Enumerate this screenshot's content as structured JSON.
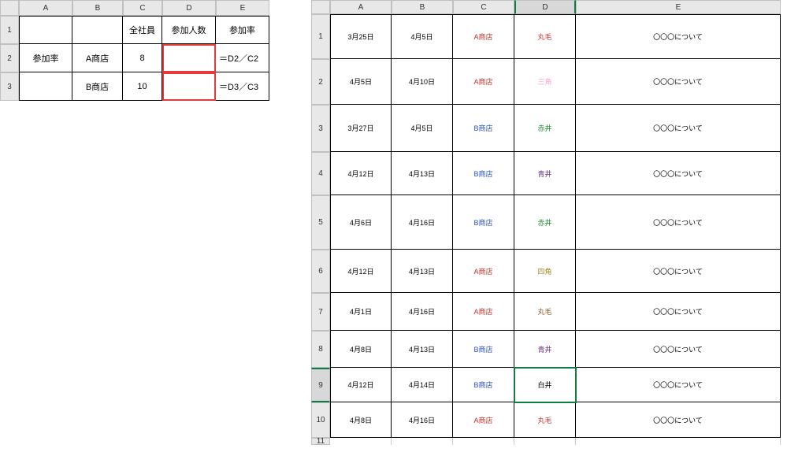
{
  "sheet1": {
    "col_headers": [
      "A",
      "B",
      "C",
      "D",
      "E"
    ],
    "row_headers": [
      "1",
      "2",
      "3"
    ],
    "cells": {
      "r1": {
        "a": "",
        "b": "",
        "c": "全社員",
        "d": "参加人数",
        "e": "参加率"
      },
      "r2": {
        "a": "参加率",
        "b": "A商店",
        "c": "8",
        "d": "",
        "e": "＝D2／C2"
      },
      "r3": {
        "a": "",
        "b": "B商店",
        "c": "10",
        "d": "",
        "e": "＝D3／C3"
      }
    }
  },
  "sheet2": {
    "col_headers": [
      "A",
      "B",
      "C",
      "D",
      "E"
    ],
    "row_headers": [
      "1",
      "2",
      "3",
      "4",
      "5",
      "6",
      "7",
      "8",
      "9",
      "10",
      "11"
    ],
    "selected_cell": "D9",
    "rows": [
      {
        "a": "3月25日",
        "b": "4月5日",
        "c": {
          "t": "A商店",
          "cls": "c-red"
        },
        "d": {
          "t": "丸毛",
          "cls": "c-red"
        },
        "e": "〇〇〇について"
      },
      {
        "a": "4月5日",
        "b": "4月10日",
        "c": {
          "t": "A商店",
          "cls": "c-red"
        },
        "d": {
          "t": "三角",
          "cls": "c-pink"
        },
        "e": "〇〇〇について"
      },
      {
        "a": "3月27日",
        "b": "4月5日",
        "c": {
          "t": "B商店",
          "cls": "c-blue"
        },
        "d": {
          "t": "赤井",
          "cls": "c-green"
        },
        "e": "〇〇〇について"
      },
      {
        "a": "4月12日",
        "b": "4月13日",
        "c": {
          "t": "B商店",
          "cls": "c-blue"
        },
        "d": {
          "t": "青井",
          "cls": "c-purple"
        },
        "e": "〇〇〇について"
      },
      {
        "a": "4月6日",
        "b": "4月16日",
        "c": {
          "t": "B商店",
          "cls": "c-blue"
        },
        "d": {
          "t": "赤井",
          "cls": "c-green"
        },
        "e": "〇〇〇について"
      },
      {
        "a": "4月12日",
        "b": "4月13日",
        "c": {
          "t": "A商店",
          "cls": "c-red"
        },
        "d": {
          "t": "四角",
          "cls": "c-olive"
        },
        "e": "〇〇〇について"
      },
      {
        "a": "4月1日",
        "b": "4月16日",
        "c": {
          "t": "A商店",
          "cls": "c-red"
        },
        "d": {
          "t": "丸毛",
          "cls": "c-brown"
        },
        "e": "〇〇〇について"
      },
      {
        "a": "4月8日",
        "b": "4月13日",
        "c": {
          "t": "B商店",
          "cls": "c-blue"
        },
        "d": {
          "t": "青井",
          "cls": "c-purple"
        },
        "e": "〇〇〇について"
      },
      {
        "a": "4月12日",
        "b": "4月14日",
        "c": {
          "t": "B商店",
          "cls": "c-blue"
        },
        "d": {
          "t": "白井",
          "cls": "c-black"
        },
        "e": "〇〇〇について"
      },
      {
        "a": "4月8日",
        "b": "4月16日",
        "c": {
          "t": "A商店",
          "cls": "c-red"
        },
        "d": {
          "t": "丸毛",
          "cls": "c-red"
        },
        "e": "〇〇〇について"
      }
    ]
  }
}
